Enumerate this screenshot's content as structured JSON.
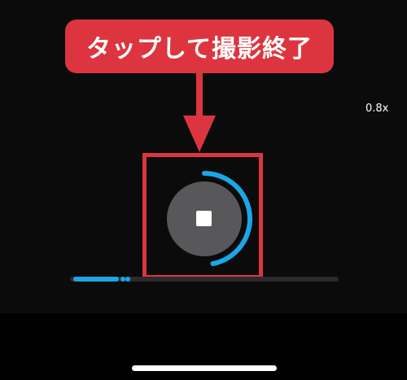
{
  "callout": {
    "text": "タップして撮影終了"
  },
  "zoom": {
    "label": "0.8x"
  },
  "recording": {
    "progress": 0.47
  },
  "colors": {
    "accent_red": "#dc3540",
    "progress_blue": "#1aa6e6",
    "button_gray": "#58585b",
    "background": "#0b0b0c"
  },
  "icons": {
    "stop": "stop-square-icon",
    "arrow": "arrow-down-icon"
  }
}
